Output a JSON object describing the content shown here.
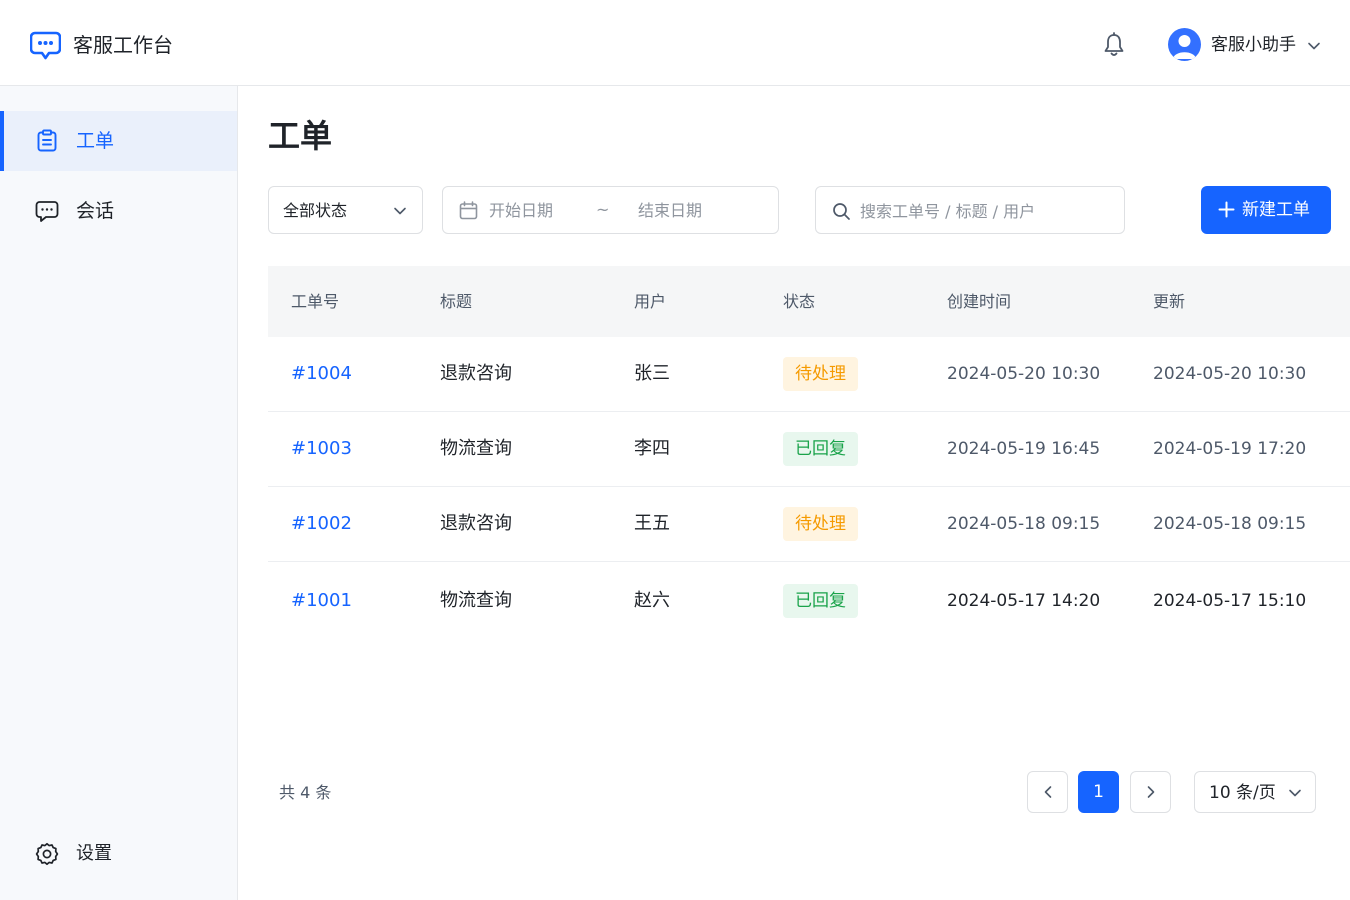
{
  "header": {
    "brand": "客服工作台",
    "user_name": "客服小助手"
  },
  "sidebar": {
    "items": [
      {
        "label": "工单",
        "icon": "clipboard-icon",
        "active": true
      },
      {
        "label": "会话",
        "icon": "chat-icon",
        "active": false
      }
    ],
    "settings_label": "设置"
  },
  "main": {
    "title": "工单",
    "filters": {
      "status_value": "全部状态",
      "start_date_placeholder": "开始日期",
      "date_separator": "~",
      "end_date_placeholder": "结束日期",
      "search_placeholder": "搜索工单号 / 标题 / 用户",
      "new_button_label": "新建工单"
    },
    "table": {
      "columns": [
        "工单号",
        "标题",
        "用户",
        "状态",
        "创建时间",
        "更新"
      ],
      "rows": [
        {
          "id": "#1004",
          "title": "退款咨询",
          "user": "张三",
          "status": "待处理",
          "created": "2024-05-20 10:30",
          "updated": "2024-05-20 10:30"
        },
        {
          "id": "#1003",
          "title": "物流查询",
          "user": "李四",
          "status": "已回复",
          "created": "2024-05-19 16:45",
          "updated": "2024-05-19 17:20"
        },
        {
          "id": "#1002",
          "title": "退款咨询",
          "user": "王五",
          "status": "待处理",
          "created": "2024-05-18 09:15",
          "updated": "2024-05-18 09:15"
        },
        {
          "id": "#1001",
          "title": "物流查询",
          "user": "赵六",
          "status": "已回复",
          "created": "2024-05-17 14:20",
          "updated": "2024-05-17 15:10"
        }
      ]
    },
    "pagination": {
      "total_text": "共 4 条",
      "current_page": "1",
      "page_size": "10 条/页"
    }
  },
  "colors": {
    "accent": "#1664ff",
    "pending_bg": "#fff4e0",
    "pending_text": "#f59a00",
    "replied_bg": "#e8f7ee",
    "replied_text": "#1aa34a"
  }
}
